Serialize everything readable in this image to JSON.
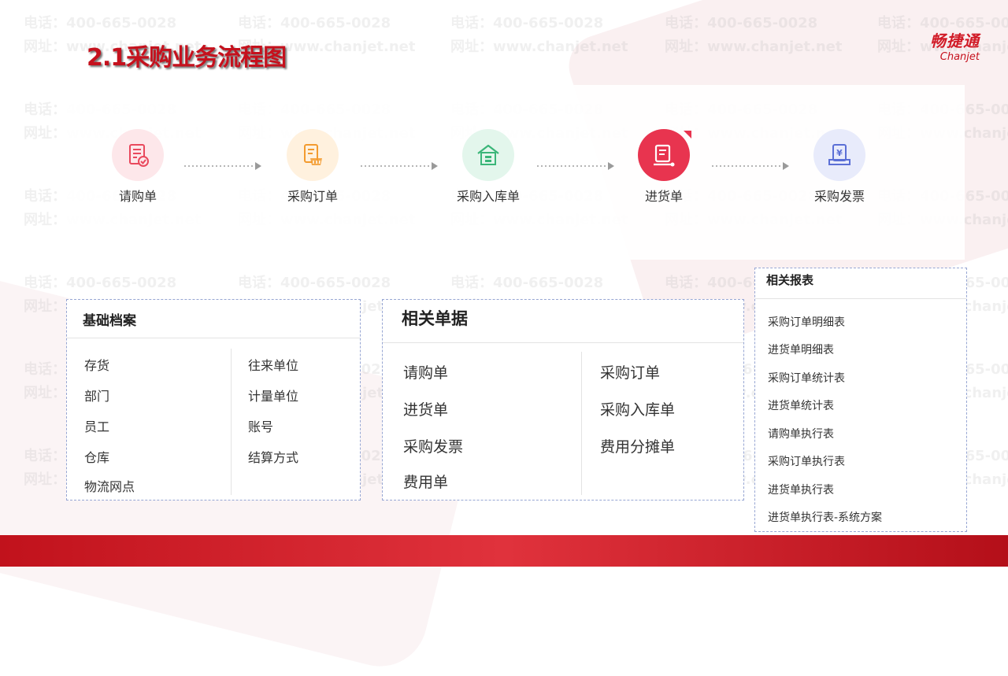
{
  "title": "2.1采购业务流程图",
  "logo": {
    "cn": "畅捷通",
    "en": "Chanjet"
  },
  "watermark": {
    "phone": "电话：400-665-0028",
    "site": "网址：www.chanjet.net"
  },
  "flow": {
    "steps": [
      {
        "label": "请购单",
        "icon": "requisition-doc-icon"
      },
      {
        "label": "采购订单",
        "icon": "purchase-order-icon"
      },
      {
        "label": "采购入库单",
        "icon": "warehouse-inbound-icon"
      },
      {
        "label": "进货单",
        "icon": "receiving-doc-icon"
      },
      {
        "label": "采购发票",
        "icon": "invoice-icon"
      }
    ]
  },
  "basic": {
    "title": "基础档案",
    "left": [
      "存货",
      "部门",
      "员工",
      "仓库",
      "物流网点"
    ],
    "right": [
      "往来单位",
      "计量单位",
      "账号",
      "结算方式"
    ]
  },
  "docs": {
    "title": "相关单据",
    "left": [
      "请购单",
      "进货单",
      "采购发票",
      "费用单"
    ],
    "right": [
      "采购订单",
      "采购入库单",
      "费用分摊单"
    ]
  },
  "reports": {
    "title": "相关报表",
    "items": [
      "采购订单明细表",
      "进货单明细表",
      "采购订单统计表",
      "进货单统计表",
      "请购单执行表",
      "采购订单执行表",
      "进货单执行表",
      "进货单执行表-系统方案"
    ]
  },
  "colors": {
    "brand_red": "#c5111d",
    "box_border": "#97a6d3",
    "step1_bg": "#fde7ea",
    "step1_fg": "#e9495d",
    "step2_bg": "#fff1de",
    "step2_fg": "#f39b2f",
    "step3_bg": "#e3f6ec",
    "step3_fg": "#3bb679",
    "step4_bg": "#e8344f",
    "step4_fg": "#ffffff",
    "step5_bg": "#e8ebfb",
    "step5_fg": "#5b6fd6"
  }
}
